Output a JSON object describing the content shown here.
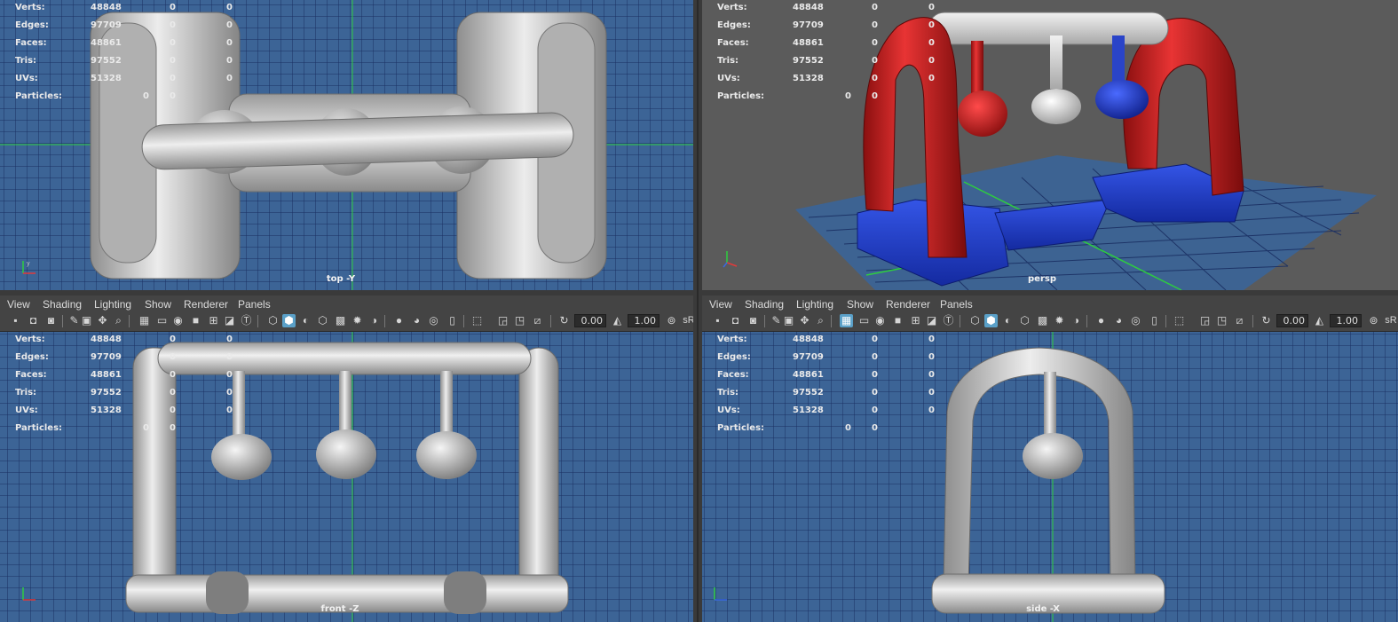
{
  "stats": {
    "rows": [
      {
        "label": "Verts:",
        "a": "48848",
        "b": "0",
        "c": "0"
      },
      {
        "label": "Edges:",
        "a": "97709",
        "b": "0",
        "c": "0"
      },
      {
        "label": "Faces:",
        "a": "48861",
        "b": "0",
        "c": "0"
      },
      {
        "label": "Tris:",
        "a": "97552",
        "b": "0",
        "c": "0"
      },
      {
        "label": "UVs:",
        "a": "51328",
        "b": "0",
        "c": "0"
      },
      {
        "label": "Particles:",
        "a": "",
        "b": "0",
        "c": "0"
      }
    ]
  },
  "viewports": {
    "top": {
      "camera": "top -Y"
    },
    "persp": {
      "camera": "persp"
    },
    "front": {
      "camera": "front -Z"
    },
    "side": {
      "camera": "side -X"
    }
  },
  "panel_menu": {
    "items": [
      "View",
      "Shading",
      "Lighting",
      "Show",
      "Renderer",
      "Panels"
    ]
  },
  "panel_toolbar": {
    "field1": "0.00",
    "field2": "1.00",
    "last_label": "sR"
  },
  "colors": {
    "viewport_bg": "#3c6496",
    "grid_line": "#1a2f63",
    "persp_bg": "#5b5b5b",
    "inflatable_red": "#c81e1e",
    "inflatable_blue": "#1e3cc8",
    "inflatable_white": "#cfcfcf"
  }
}
